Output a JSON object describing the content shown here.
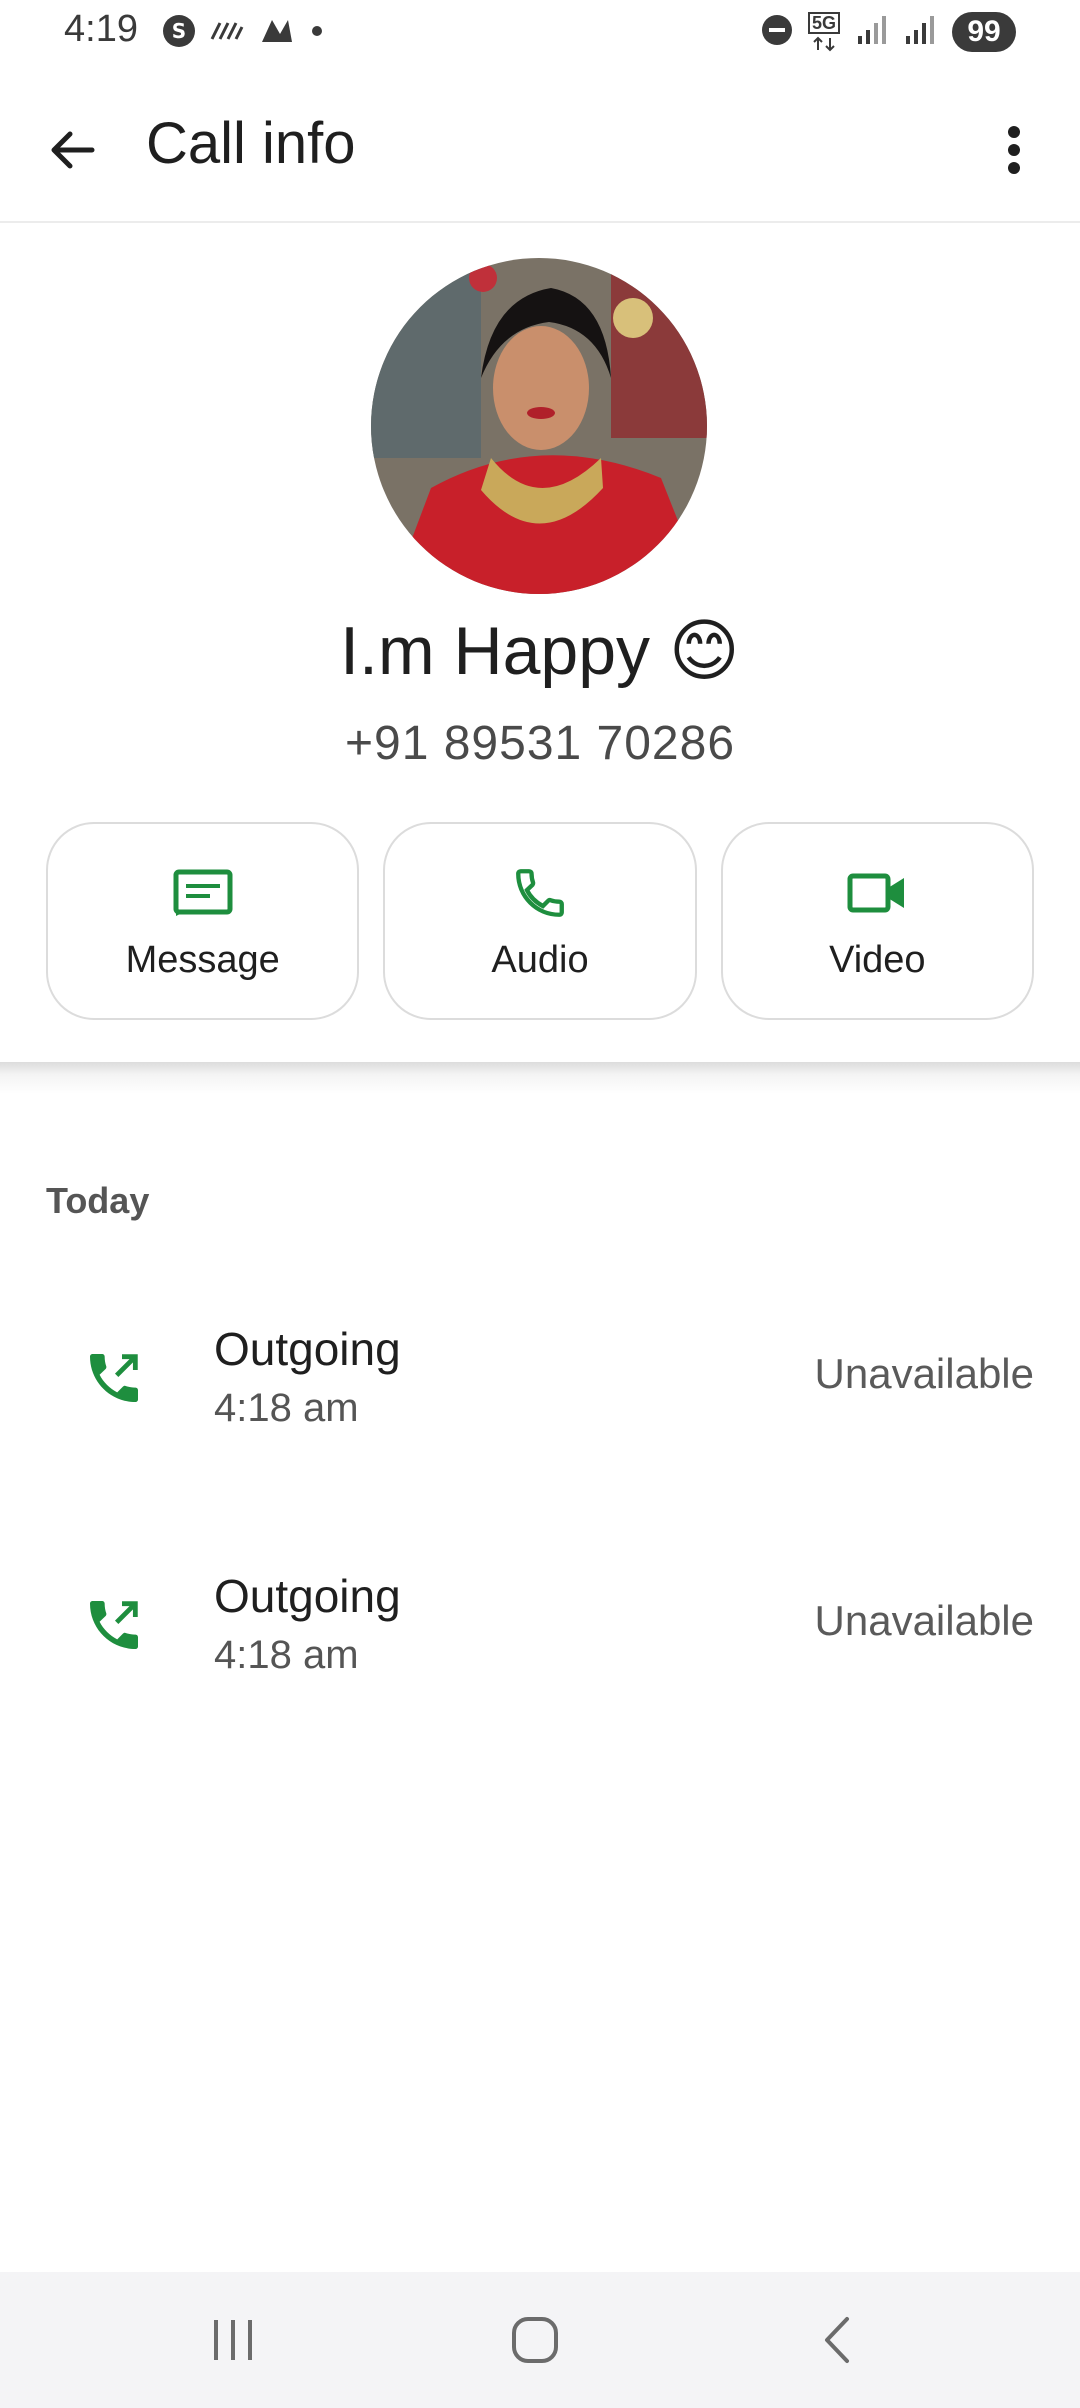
{
  "status_bar": {
    "time": "4:19",
    "network": "5G",
    "battery": "99"
  },
  "app_bar": {
    "title": "Call info"
  },
  "contact": {
    "name": "I.m Happy 😊",
    "number": "+91 89531 70286"
  },
  "actions": [
    {
      "label": "Message",
      "icon": "message-icon"
    },
    {
      "label": "Audio",
      "icon": "phone-icon"
    },
    {
      "label": "Video",
      "icon": "video-icon"
    }
  ],
  "history": {
    "section_label": "Today",
    "calls": [
      {
        "type": "Outgoing",
        "time": "4:18 am",
        "status": "Unavailable",
        "icon": "outgoing-call-icon"
      },
      {
        "type": "Outgoing",
        "time": "4:18 am",
        "status": "Unavailable",
        "icon": "outgoing-call-icon"
      }
    ]
  },
  "colors": {
    "accent_green": "#1e8e3e",
    "text_primary": "#1f1f1f",
    "text_secondary": "#555555"
  }
}
